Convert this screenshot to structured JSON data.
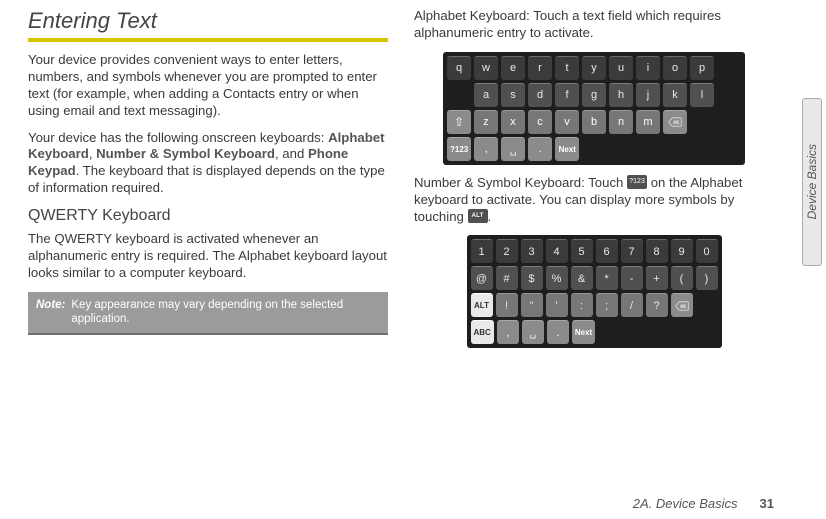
{
  "side_tab": "Device Basics",
  "footer": {
    "section": "2A. Device Basics",
    "page": "31"
  },
  "left": {
    "h1": "Entering Text",
    "p1": "Your device provides convenient ways to enter letters, numbers, and symbols whenever you are prompted to enter text (for example, when adding a Contacts entry or when using email and text messaging).",
    "p2_pre": "Your device has the following onscreen keyboards: ",
    "p2_b1": "Alphabet Keyboard",
    "p2_mid1": ", ",
    "p2_b2": "Number & Symbol Keyboard",
    "p2_mid2": ", and ",
    "p2_b3": "Phone Keypad",
    "p2_post": ". The keyboard that is displayed depends on the type of information required.",
    "h2": "QWERTY Keyboard",
    "p3": "The QWERTY keyboard is activated whenever an alphanumeric entry is required. The Alphabet keyboard layout looks similar to a computer keyboard.",
    "note_label": "Note:",
    "note_text": "Key appearance may vary depending on the selected application."
  },
  "right": {
    "p1": "Alphabet Keyboard: Touch a text field which requires alphanumeric entry to activate.",
    "p2_pre": "Number & Symbol Keyboard: Touch ",
    "icon1_text": "?123",
    "p2_mid": " on the Alphabet keyboard to activate.  You can display more symbols by touching ",
    "icon2_text": "ALT",
    "p2_post": "."
  },
  "alpha_keyboard": {
    "rows": [
      [
        "q",
        "w",
        "e",
        "r",
        "t",
        "y",
        "u",
        "i",
        "o",
        "p"
      ],
      [
        "a",
        "s",
        "d",
        "f",
        "g",
        "h",
        "j",
        "k",
        "l"
      ],
      [
        "⇧",
        "z",
        "x",
        "c",
        "v",
        "b",
        "n",
        "m",
        "DEL"
      ],
      [
        "?123",
        ",",
        "␣",
        ".",
        "Next"
      ]
    ]
  },
  "num_keyboard": {
    "rows": [
      [
        "1",
        "2",
        "3",
        "4",
        "5",
        "6",
        "7",
        "8",
        "9",
        "0"
      ],
      [
        "@",
        "#",
        "$",
        "%",
        "&",
        "*",
        "-",
        "+",
        "(",
        ")"
      ],
      [
        "ALT",
        "!",
        "\"",
        "'",
        ":",
        ";",
        "/",
        "?",
        "DEL"
      ],
      [
        "ABC",
        ",",
        "␣",
        ".",
        "Next"
      ]
    ]
  }
}
